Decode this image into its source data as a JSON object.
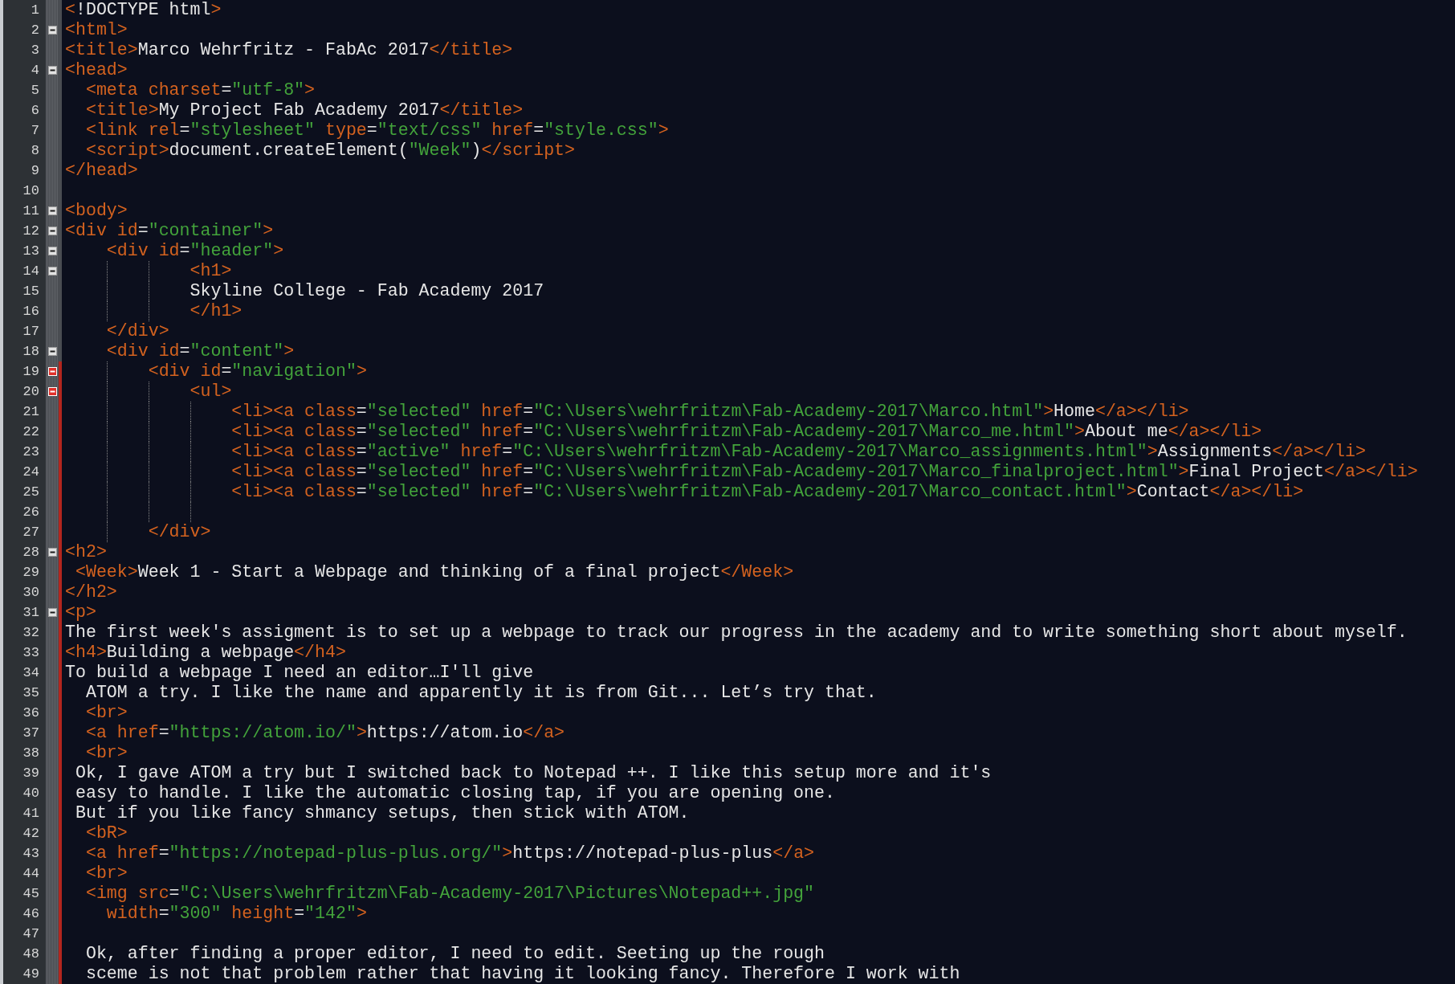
{
  "editor": {
    "lines": [
      {
        "number": "1",
        "tokens": [
          {
            "kind": "tag",
            "text": "<"
          },
          {
            "kind": "text",
            "text": "!DOCTYPE html"
          },
          {
            "kind": "tag",
            "text": ">"
          }
        ]
      },
      {
        "number": "2",
        "foldable": true,
        "fold_highlighted": false,
        "tokens": [
          {
            "kind": "tag",
            "text": "<html>"
          }
        ]
      },
      {
        "number": "3",
        "tokens": [
          {
            "kind": "tag",
            "text": "<title>"
          },
          {
            "kind": "text",
            "text": "Marco Wehrfritz - FabAc 2017"
          },
          {
            "kind": "tag",
            "text": "</title>"
          }
        ]
      },
      {
        "number": "4",
        "foldable": true,
        "fold_highlighted": false,
        "tokens": [
          {
            "kind": "tag",
            "text": "<head>"
          }
        ]
      },
      {
        "number": "5",
        "tokens": [
          {
            "kind": "tag",
            "text": "  <meta charset"
          },
          {
            "kind": "eq",
            "text": "="
          },
          {
            "kind": "str",
            "text": "\"utf-8\""
          },
          {
            "kind": "tag",
            "text": ">"
          }
        ]
      },
      {
        "number": "6",
        "tokens": [
          {
            "kind": "tag",
            "text": "  <title>"
          },
          {
            "kind": "text",
            "text": "My Project Fab Academy 2017"
          },
          {
            "kind": "tag",
            "text": "</title>"
          }
        ]
      },
      {
        "number": "7",
        "tokens": [
          {
            "kind": "tag",
            "text": "  <link rel"
          },
          {
            "kind": "eq",
            "text": "="
          },
          {
            "kind": "str",
            "text": "\"stylesheet\""
          },
          {
            "kind": "tag",
            "text": " type"
          },
          {
            "kind": "eq",
            "text": "="
          },
          {
            "kind": "str",
            "text": "\"text/css\""
          },
          {
            "kind": "tag",
            "text": " href"
          },
          {
            "kind": "eq",
            "text": "="
          },
          {
            "kind": "str",
            "text": "\"style.css\""
          },
          {
            "kind": "tag",
            "text": ">"
          }
        ]
      },
      {
        "number": "8",
        "tokens": [
          {
            "kind": "tag",
            "text": "  <script>"
          },
          {
            "kind": "text",
            "text": "document.createElement("
          },
          {
            "kind": "str",
            "text": "\"Week\""
          },
          {
            "kind": "text",
            "text": ")"
          },
          {
            "kind": "tag",
            "text": "</script>"
          }
        ]
      },
      {
        "number": "9",
        "tokens": [
          {
            "kind": "tag",
            "text": "</head>"
          }
        ]
      },
      {
        "number": "10"
      },
      {
        "number": "11",
        "foldable": true,
        "fold_highlighted": false,
        "tokens": [
          {
            "kind": "tag",
            "text": "<body>"
          }
        ]
      },
      {
        "number": "12",
        "foldable": true,
        "fold_highlighted": false,
        "tokens": [
          {
            "kind": "tag",
            "text": "<div id"
          },
          {
            "kind": "eq",
            "text": "="
          },
          {
            "kind": "str",
            "text": "\"container\""
          },
          {
            "kind": "tag",
            "text": ">"
          }
        ]
      },
      {
        "number": "13",
        "foldable": true,
        "fold_highlighted": false,
        "tokens": [
          {
            "kind": "tag",
            "text": "    <div id"
          },
          {
            "kind": "eq",
            "text": "="
          },
          {
            "kind": "str",
            "text": "\"header\""
          },
          {
            "kind": "tag",
            "text": ">"
          }
        ]
      },
      {
        "number": "14",
        "foldable": true,
        "fold_highlighted": false,
        "tokens": [
          {
            "kind": "tag",
            "text": "            <h1>"
          }
        ]
      },
      {
        "number": "15",
        "tokens": [
          {
            "kind": "text",
            "text": "            Skyline College - Fab Academy 2017"
          }
        ]
      },
      {
        "number": "16",
        "tokens": [
          {
            "kind": "tag",
            "text": "            </h1>"
          }
        ]
      },
      {
        "number": "17",
        "tokens": [
          {
            "kind": "tag",
            "text": "    </div>"
          }
        ]
      },
      {
        "number": "18",
        "foldable": true,
        "fold_highlighted": false,
        "tokens": [
          {
            "kind": "tag",
            "text": "    <div id"
          },
          {
            "kind": "eq",
            "text": "="
          },
          {
            "kind": "str",
            "text": "\"content\""
          },
          {
            "kind": "tag",
            "text": ">"
          }
        ]
      },
      {
        "number": "19",
        "foldable": true,
        "fold_highlighted": true,
        "modified": true,
        "tokens": [
          {
            "kind": "tag",
            "text": "        <div id"
          },
          {
            "kind": "eq",
            "text": "="
          },
          {
            "kind": "str",
            "text": "\"navigation\""
          },
          {
            "kind": "tag",
            "text": ">"
          }
        ]
      },
      {
        "number": "20",
        "foldable": true,
        "fold_highlighted": true,
        "modified": true,
        "tokens": [
          {
            "kind": "tag",
            "text": "            <ul>"
          }
        ]
      },
      {
        "number": "21",
        "modified": true,
        "tokens": [
          {
            "kind": "tag",
            "text": "                <li><a class"
          },
          {
            "kind": "eq",
            "text": "="
          },
          {
            "kind": "str",
            "text": "\"selected\""
          },
          {
            "kind": "tag",
            "text": " href"
          },
          {
            "kind": "eq",
            "text": "="
          },
          {
            "kind": "str",
            "text": "\"C:\\Users\\wehrfritzm\\Fab-Academy-2017\\Marco.html\""
          },
          {
            "kind": "tag",
            "text": ">"
          },
          {
            "kind": "text",
            "text": "Home"
          },
          {
            "kind": "tag",
            "text": "</a></li>"
          }
        ]
      },
      {
        "number": "22",
        "modified": true,
        "tokens": [
          {
            "kind": "tag",
            "text": "                <li><a class"
          },
          {
            "kind": "eq",
            "text": "="
          },
          {
            "kind": "str",
            "text": "\"selected\""
          },
          {
            "kind": "tag",
            "text": " href"
          },
          {
            "kind": "eq",
            "text": "="
          },
          {
            "kind": "str",
            "text": "\"C:\\Users\\wehrfritzm\\Fab-Academy-2017\\Marco_me.html\""
          },
          {
            "kind": "tag",
            "text": ">"
          },
          {
            "kind": "text",
            "text": "About me"
          },
          {
            "kind": "tag",
            "text": "</a></li>"
          }
        ]
      },
      {
        "number": "23",
        "modified": true,
        "tokens": [
          {
            "kind": "tag",
            "text": "                <li><a class"
          },
          {
            "kind": "eq",
            "text": "="
          },
          {
            "kind": "str",
            "text": "\"active\""
          },
          {
            "kind": "tag",
            "text": " href"
          },
          {
            "kind": "eq",
            "text": "="
          },
          {
            "kind": "str",
            "text": "\"C:\\Users\\wehrfritzm\\Fab-Academy-2017\\Marco_assignments.html\""
          },
          {
            "kind": "tag",
            "text": ">"
          },
          {
            "kind": "text",
            "text": "Assignments"
          },
          {
            "kind": "tag",
            "text": "</a></li>"
          }
        ]
      },
      {
        "number": "24",
        "modified": true,
        "tokens": [
          {
            "kind": "tag",
            "text": "                <li><a class"
          },
          {
            "kind": "eq",
            "text": "="
          },
          {
            "kind": "str",
            "text": "\"selected\""
          },
          {
            "kind": "tag",
            "text": " href"
          },
          {
            "kind": "eq",
            "text": "="
          },
          {
            "kind": "str",
            "text": "\"C:\\Users\\wehrfritzm\\Fab-Academy-2017\\Marco_finalproject.html\""
          },
          {
            "kind": "tag",
            "text": ">"
          },
          {
            "kind": "text",
            "text": "Final Project"
          },
          {
            "kind": "tag",
            "text": "</a></li>"
          }
        ]
      },
      {
        "number": "25",
        "modified": true,
        "tokens": [
          {
            "kind": "tag",
            "text": "                <li><a class"
          },
          {
            "kind": "eq",
            "text": "="
          },
          {
            "kind": "str",
            "text": "\"selected\""
          },
          {
            "kind": "tag",
            "text": " href"
          },
          {
            "kind": "eq",
            "text": "="
          },
          {
            "kind": "str",
            "text": "\"C:\\Users\\wehrfritzm\\Fab-Academy-2017\\Marco_contact.html\""
          },
          {
            "kind": "tag",
            "text": ">"
          },
          {
            "kind": "text",
            "text": "Contact"
          },
          {
            "kind": "tag",
            "text": "</a></li>"
          }
        ]
      },
      {
        "number": "26",
        "modified": true
      },
      {
        "number": "27",
        "modified": true,
        "tokens": [
          {
            "kind": "tag",
            "text": "        </div>"
          }
        ]
      },
      {
        "number": "28",
        "foldable": true,
        "fold_highlighted": false,
        "modified": true,
        "tokens": [
          {
            "kind": "tag",
            "text": "<h2>"
          }
        ]
      },
      {
        "number": "29",
        "modified": true,
        "tokens": [
          {
            "kind": "tag",
            "text": " <Week>"
          },
          {
            "kind": "text",
            "text": "Week 1 - Start a Webpage and thinking of a final project"
          },
          {
            "kind": "tag",
            "text": "</Week>"
          }
        ]
      },
      {
        "number": "30",
        "modified": true,
        "tokens": [
          {
            "kind": "tag",
            "text": "</h2>"
          }
        ]
      },
      {
        "number": "31",
        "foldable": true,
        "fold_highlighted": false,
        "modified": true,
        "tokens": [
          {
            "kind": "tag",
            "text": "<p>"
          }
        ]
      },
      {
        "number": "32",
        "modified": true,
        "tokens": [
          {
            "kind": "text",
            "text": "The first week's assigment is to set up a webpage to track our progress in the academy and to write something short about myself."
          }
        ]
      },
      {
        "number": "33",
        "modified": true,
        "tokens": [
          {
            "kind": "tag",
            "text": "<h4>"
          },
          {
            "kind": "text",
            "text": "Building a webpage"
          },
          {
            "kind": "tag",
            "text": "</h4>"
          }
        ]
      },
      {
        "number": "34",
        "modified": true,
        "tokens": [
          {
            "kind": "text",
            "text": "To build a webpage I need an editor…I'll give"
          }
        ]
      },
      {
        "number": "35",
        "modified": true,
        "tokens": [
          {
            "kind": "text",
            "text": "  ATOM a try. I like the name and apparently it is from Git... Let’s try that."
          }
        ]
      },
      {
        "number": "36",
        "modified": true,
        "tokens": [
          {
            "kind": "tag",
            "text": "  <br>"
          }
        ]
      },
      {
        "number": "37",
        "modified": true,
        "tokens": [
          {
            "kind": "tag",
            "text": "  <a href"
          },
          {
            "kind": "eq",
            "text": "="
          },
          {
            "kind": "str",
            "text": "\"https://atom.io/\""
          },
          {
            "kind": "tag",
            "text": ">"
          },
          {
            "kind": "text",
            "text": "https://atom.io"
          },
          {
            "kind": "tag",
            "text": "</a>"
          }
        ]
      },
      {
        "number": "38",
        "modified": true,
        "tokens": [
          {
            "kind": "tag",
            "text": "  <br>"
          }
        ]
      },
      {
        "number": "39",
        "modified": true,
        "tokens": [
          {
            "kind": "text",
            "text": " Ok, I gave ATOM a try but I switched back to Notepad ++. I like this setup more and it's"
          }
        ]
      },
      {
        "number": "40",
        "modified": true,
        "tokens": [
          {
            "kind": "text",
            "text": " easy to handle. I like the automatic closing tap, if you are opening one."
          }
        ]
      },
      {
        "number": "41",
        "modified": true,
        "tokens": [
          {
            "kind": "text",
            "text": " But if you like fancy shmancy setups, then stick with ATOM."
          }
        ]
      },
      {
        "number": "42",
        "modified": true,
        "tokens": [
          {
            "kind": "tag",
            "text": "  <bR>"
          }
        ]
      },
      {
        "number": "43",
        "modified": true,
        "tokens": [
          {
            "kind": "tag",
            "text": "  <a href"
          },
          {
            "kind": "eq",
            "text": "="
          },
          {
            "kind": "str",
            "text": "\"https://notepad-plus-plus.org/\""
          },
          {
            "kind": "tag",
            "text": ">"
          },
          {
            "kind": "text",
            "text": "https://notepad-plus-plus"
          },
          {
            "kind": "tag",
            "text": "</a>"
          }
        ]
      },
      {
        "number": "44",
        "modified": true,
        "tokens": [
          {
            "kind": "tag",
            "text": "  <br>"
          }
        ]
      },
      {
        "number": "45",
        "modified": true,
        "tokens": [
          {
            "kind": "tag",
            "text": "  <img src"
          },
          {
            "kind": "eq",
            "text": "="
          },
          {
            "kind": "str",
            "text": "\"C:\\Users\\wehrfritzm\\Fab-Academy-2017\\Pictures\\Notepad++.jpg\""
          }
        ]
      },
      {
        "number": "46",
        "modified": true,
        "tokens": [
          {
            "kind": "tag",
            "text": "    width"
          },
          {
            "kind": "eq",
            "text": "="
          },
          {
            "kind": "str",
            "text": "\"300\""
          },
          {
            "kind": "tag",
            "text": " height"
          },
          {
            "kind": "eq",
            "text": "="
          },
          {
            "kind": "str",
            "text": "\"142\""
          },
          {
            "kind": "tag",
            "text": ">"
          }
        ]
      },
      {
        "number": "47",
        "modified": true
      },
      {
        "number": "48",
        "modified": true,
        "tokens": [
          {
            "kind": "text",
            "text": "  Ok, after finding a proper editor, I need to edit. Seeting up the rough"
          }
        ]
      },
      {
        "number": "49",
        "modified": true,
        "tokens": [
          {
            "kind": "text",
            "text": "  sceme is not that problem rather that having it looking fancy. Therefore I work with"
          }
        ]
      }
    ]
  }
}
